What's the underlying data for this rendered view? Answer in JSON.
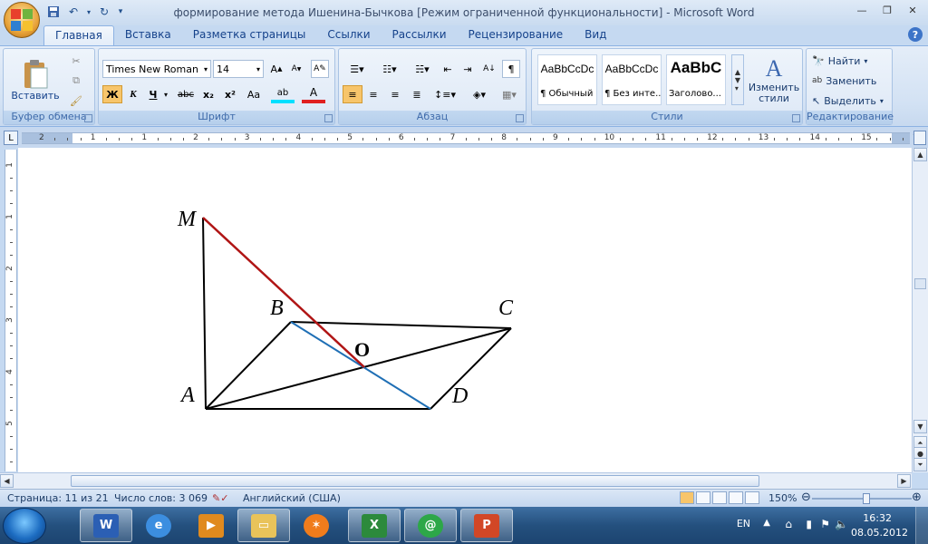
{
  "window": {
    "title": "формирование метода Ишенина-Бычкова [Режим ограниченной функциональности] - Microsoft Word"
  },
  "tabs": [
    "Главная",
    "Вставка",
    "Разметка страницы",
    "Ссылки",
    "Рассылки",
    "Рецензирование",
    "Вид"
  ],
  "ribbon": {
    "clipboard": {
      "paste": "Вставить",
      "label": "Буфер обмена"
    },
    "font": {
      "name": "Times New Roman",
      "size": "14",
      "label": "Шрифт",
      "bold": "Ж",
      "italic": "К",
      "underline": "Ч",
      "strike": "abc",
      "sub": "x₂",
      "sup": "x²",
      "case": "Aa"
    },
    "paragraph": {
      "label": "Абзац"
    },
    "styles": {
      "label": "Стили",
      "items": [
        {
          "sample": "AaBbCcDc",
          "name": "¶ Обычный"
        },
        {
          "sample": "AaBbCcDc",
          "name": "¶ Без инте..."
        },
        {
          "sample": "AaBbC",
          "name": "Заголово..."
        }
      ],
      "change": "Изменить стили"
    },
    "editing": {
      "find": "Найти",
      "replace": "Заменить",
      "select": "Выделить",
      "label": "Редактирование"
    }
  },
  "ruler": {
    "numbers": [
      "2",
      "1",
      "1",
      "2",
      "3",
      "4",
      "5",
      "6",
      "7",
      "8",
      "9",
      "10",
      "11",
      "12",
      "13",
      "14",
      "15",
      "16"
    ],
    "vnumbers": [
      "1",
      "1",
      "2",
      "3",
      "4",
      "5",
      "6"
    ]
  },
  "figure": {
    "labels": {
      "M": "M",
      "A": "A",
      "B": "B",
      "C": "C",
      "D": "D",
      "O": "O"
    },
    "colors": {
      "edge": "#000000",
      "diagonal_bd": "#1f6fb5",
      "segment_mo": "#b01515"
    }
  },
  "statusbar": {
    "page": "Страница: 11 из 21",
    "words": "Число слов: 3 069",
    "language": "Английский (США)",
    "zoom": "150%"
  },
  "taskbar": {
    "lang": "EN",
    "time": "16:32",
    "date": "08.05.2012"
  }
}
